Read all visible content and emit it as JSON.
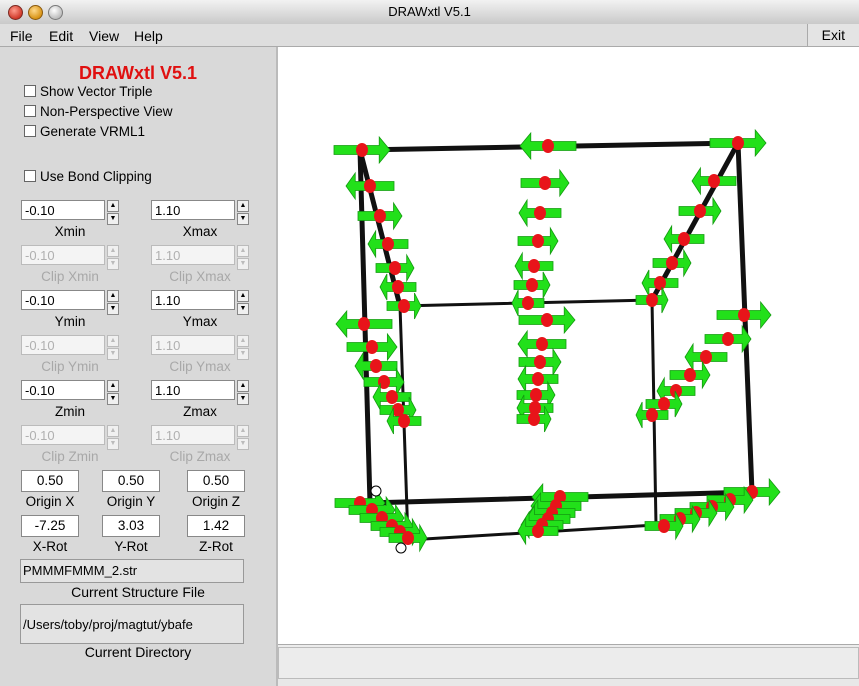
{
  "window": {
    "title": "DRAWxtl V5.1"
  },
  "menu": {
    "file": "File",
    "edit": "Edit",
    "view": "View",
    "help": "Help",
    "exit": "Exit"
  },
  "panel": {
    "app_title": "DRAWxtl V5.1",
    "show_vector_triple": "Show Vector Triple",
    "non_perspective": "Non-Perspective View",
    "generate_vrml": "Generate VRML1",
    "use_bond_clipping": "Use Bond Clipping",
    "xmin": {
      "value": "-0.10",
      "label": "Xmin"
    },
    "xmax": {
      "value": "1.10",
      "label": "Xmax"
    },
    "clip_xmin": {
      "value": "-0.10",
      "label": "Clip Xmin"
    },
    "clip_xmax": {
      "value": "1.10",
      "label": "Clip Xmax"
    },
    "ymin": {
      "value": "-0.10",
      "label": "Ymin"
    },
    "ymax": {
      "value": "1.10",
      "label": "Ymax"
    },
    "clip_ymin": {
      "value": "-0.10",
      "label": "Clip Ymin"
    },
    "clip_ymax": {
      "value": "1.10",
      "label": "Clip Ymax"
    },
    "zmin": {
      "value": "-0.10",
      "label": "Zmin"
    },
    "zmax": {
      "value": "1.10",
      "label": "Zmax"
    },
    "clip_zmin": {
      "value": "-0.10",
      "label": "Clip Zmin"
    },
    "clip_zmax": {
      "value": "1.10",
      "label": "Clip Zmax"
    },
    "origin_x": {
      "value": "0.50",
      "label": "Origin X"
    },
    "origin_y": {
      "value": "0.50",
      "label": "Origin Y"
    },
    "origin_z": {
      "value": "0.50",
      "label": "Origin Z"
    },
    "x_rot": {
      "value": "-7.25",
      "label": "X-Rot"
    },
    "y_rot": {
      "value": "3.03",
      "label": "Y-Rot"
    },
    "z_rot": {
      "value": "1.42",
      "label": "Z-Rot"
    },
    "structure_file": {
      "value": "PMMMFMMM_2.str",
      "label": "Current Structure File"
    },
    "directory": {
      "value": "/Users/toby/proj/magtut/ybafe",
      "label": "Current Directory"
    }
  },
  "colors": {
    "title_red": "#e01010",
    "atom_red": "#e8141a",
    "arrow_green": "#22e01a",
    "bond_black": "#111111"
  },
  "viewer": {
    "icon": "crystal-structure-3d-view"
  }
}
